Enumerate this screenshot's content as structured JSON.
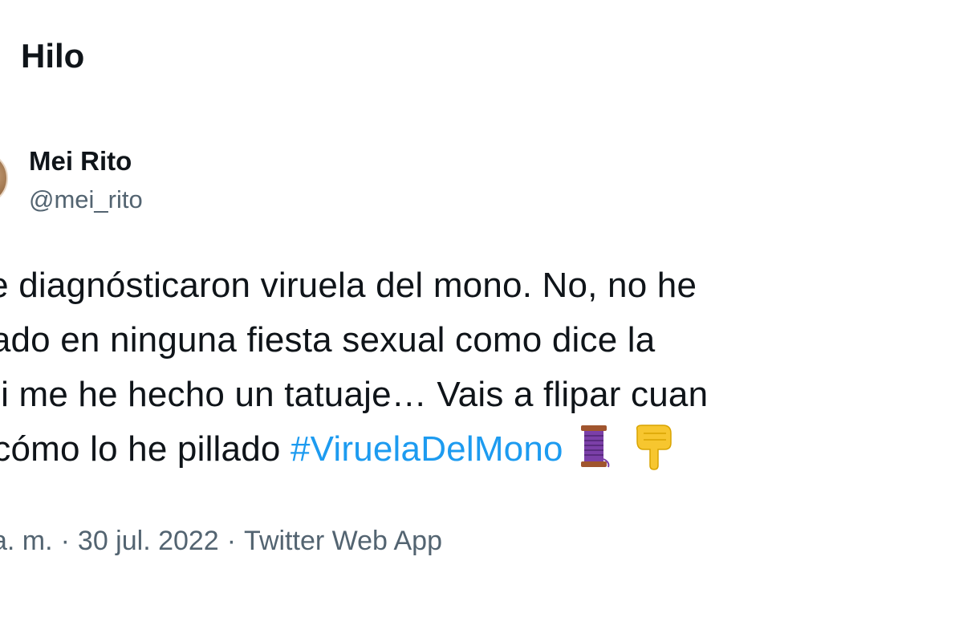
{
  "header": {
    "title": "Hilo"
  },
  "author": {
    "name": "Mei Rito",
    "handle": "@mei_rito"
  },
  "tweet": {
    "lines": [
      "r me diagnósticaron viruela del mono. No, no he",
      "icipado en ninguna fiesta sexual como dice la",
      "S, ni me he hecho un tatuaje… Vais a flipar cuan"
    ],
    "last_line_prefix": "nis cómo lo he pillado ",
    "hashtag": "#ViruelaDelMono",
    "emojis": [
      "thread-spool-icon",
      "pointing-down-hand-icon"
    ]
  },
  "meta": {
    "time": "a. m.",
    "separator": "·",
    "date": "30 jul. 2022",
    "source": "Twitter Web App"
  },
  "colors": {
    "hashtag": "#1d9bf0",
    "secondary_text": "#536471",
    "primary_text": "#0f1419"
  }
}
